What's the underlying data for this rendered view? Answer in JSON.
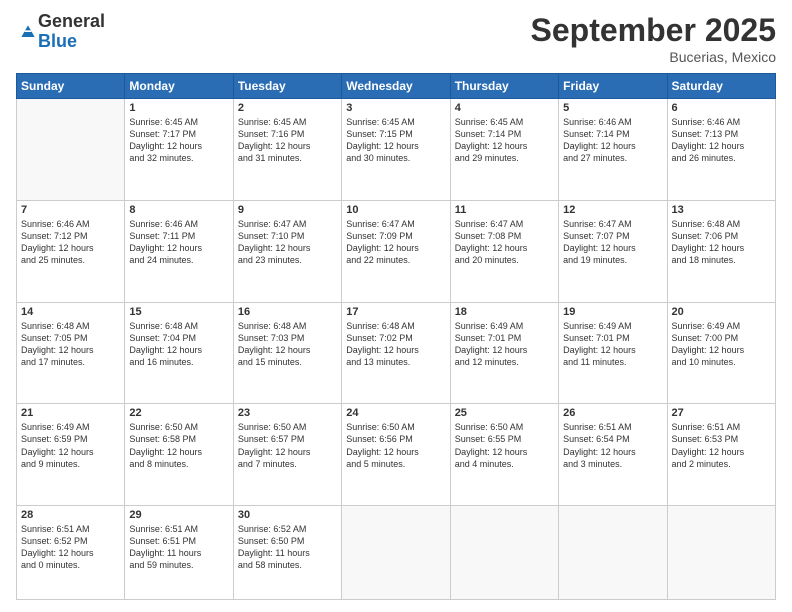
{
  "logo": {
    "general": "General",
    "blue": "Blue"
  },
  "header": {
    "month": "September 2025",
    "location": "Bucerias, Mexico"
  },
  "weekdays": [
    "Sunday",
    "Monday",
    "Tuesday",
    "Wednesday",
    "Thursday",
    "Friday",
    "Saturday"
  ],
  "weeks": [
    [
      {
        "num": "",
        "info": ""
      },
      {
        "num": "1",
        "info": "Sunrise: 6:45 AM\nSunset: 7:17 PM\nDaylight: 12 hours\nand 32 minutes."
      },
      {
        "num": "2",
        "info": "Sunrise: 6:45 AM\nSunset: 7:16 PM\nDaylight: 12 hours\nand 31 minutes."
      },
      {
        "num": "3",
        "info": "Sunrise: 6:45 AM\nSunset: 7:15 PM\nDaylight: 12 hours\nand 30 minutes."
      },
      {
        "num": "4",
        "info": "Sunrise: 6:45 AM\nSunset: 7:14 PM\nDaylight: 12 hours\nand 29 minutes."
      },
      {
        "num": "5",
        "info": "Sunrise: 6:46 AM\nSunset: 7:14 PM\nDaylight: 12 hours\nand 27 minutes."
      },
      {
        "num": "6",
        "info": "Sunrise: 6:46 AM\nSunset: 7:13 PM\nDaylight: 12 hours\nand 26 minutes."
      }
    ],
    [
      {
        "num": "7",
        "info": "Sunrise: 6:46 AM\nSunset: 7:12 PM\nDaylight: 12 hours\nand 25 minutes."
      },
      {
        "num": "8",
        "info": "Sunrise: 6:46 AM\nSunset: 7:11 PM\nDaylight: 12 hours\nand 24 minutes."
      },
      {
        "num": "9",
        "info": "Sunrise: 6:47 AM\nSunset: 7:10 PM\nDaylight: 12 hours\nand 23 minutes."
      },
      {
        "num": "10",
        "info": "Sunrise: 6:47 AM\nSunset: 7:09 PM\nDaylight: 12 hours\nand 22 minutes."
      },
      {
        "num": "11",
        "info": "Sunrise: 6:47 AM\nSunset: 7:08 PM\nDaylight: 12 hours\nand 20 minutes."
      },
      {
        "num": "12",
        "info": "Sunrise: 6:47 AM\nSunset: 7:07 PM\nDaylight: 12 hours\nand 19 minutes."
      },
      {
        "num": "13",
        "info": "Sunrise: 6:48 AM\nSunset: 7:06 PM\nDaylight: 12 hours\nand 18 minutes."
      }
    ],
    [
      {
        "num": "14",
        "info": "Sunrise: 6:48 AM\nSunset: 7:05 PM\nDaylight: 12 hours\nand 17 minutes."
      },
      {
        "num": "15",
        "info": "Sunrise: 6:48 AM\nSunset: 7:04 PM\nDaylight: 12 hours\nand 16 minutes."
      },
      {
        "num": "16",
        "info": "Sunrise: 6:48 AM\nSunset: 7:03 PM\nDaylight: 12 hours\nand 15 minutes."
      },
      {
        "num": "17",
        "info": "Sunrise: 6:48 AM\nSunset: 7:02 PM\nDaylight: 12 hours\nand 13 minutes."
      },
      {
        "num": "18",
        "info": "Sunrise: 6:49 AM\nSunset: 7:01 PM\nDaylight: 12 hours\nand 12 minutes."
      },
      {
        "num": "19",
        "info": "Sunrise: 6:49 AM\nSunset: 7:01 PM\nDaylight: 12 hours\nand 11 minutes."
      },
      {
        "num": "20",
        "info": "Sunrise: 6:49 AM\nSunset: 7:00 PM\nDaylight: 12 hours\nand 10 minutes."
      }
    ],
    [
      {
        "num": "21",
        "info": "Sunrise: 6:49 AM\nSunset: 6:59 PM\nDaylight: 12 hours\nand 9 minutes."
      },
      {
        "num": "22",
        "info": "Sunrise: 6:50 AM\nSunset: 6:58 PM\nDaylight: 12 hours\nand 8 minutes."
      },
      {
        "num": "23",
        "info": "Sunrise: 6:50 AM\nSunset: 6:57 PM\nDaylight: 12 hours\nand 7 minutes."
      },
      {
        "num": "24",
        "info": "Sunrise: 6:50 AM\nSunset: 6:56 PM\nDaylight: 12 hours\nand 5 minutes."
      },
      {
        "num": "25",
        "info": "Sunrise: 6:50 AM\nSunset: 6:55 PM\nDaylight: 12 hours\nand 4 minutes."
      },
      {
        "num": "26",
        "info": "Sunrise: 6:51 AM\nSunset: 6:54 PM\nDaylight: 12 hours\nand 3 minutes."
      },
      {
        "num": "27",
        "info": "Sunrise: 6:51 AM\nSunset: 6:53 PM\nDaylight: 12 hours\nand 2 minutes."
      }
    ],
    [
      {
        "num": "28",
        "info": "Sunrise: 6:51 AM\nSunset: 6:52 PM\nDaylight: 12 hours\nand 0 minutes."
      },
      {
        "num": "29",
        "info": "Sunrise: 6:51 AM\nSunset: 6:51 PM\nDaylight: 11 hours\nand 59 minutes."
      },
      {
        "num": "30",
        "info": "Sunrise: 6:52 AM\nSunset: 6:50 PM\nDaylight: 11 hours\nand 58 minutes."
      },
      {
        "num": "",
        "info": ""
      },
      {
        "num": "",
        "info": ""
      },
      {
        "num": "",
        "info": ""
      },
      {
        "num": "",
        "info": ""
      }
    ]
  ]
}
